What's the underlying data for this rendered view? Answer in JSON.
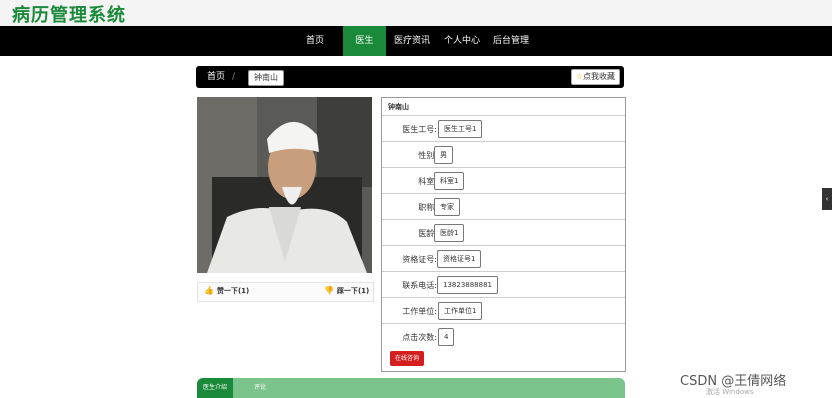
{
  "site": {
    "title": "病历管理系统"
  },
  "nav": {
    "items": [
      {
        "label": "首页"
      },
      {
        "label": "医生"
      },
      {
        "label": "医疗资讯"
      },
      {
        "label": "个人中心"
      },
      {
        "label": "后台管理"
      }
    ],
    "active_index": 1
  },
  "breadcrumb": {
    "home": "首页",
    "separator": "/",
    "current": "钟南山",
    "favorite_label": "点我收藏",
    "favorite_icon": "star-icon"
  },
  "actions": {
    "like": {
      "label": "赞一下(1)",
      "icon": "thumbs-up-icon"
    },
    "dislike": {
      "label": "踩一下(1)",
      "icon": "thumbs-down-icon"
    }
  },
  "doctor": {
    "name": "钟南山",
    "fields": [
      {
        "label": "医生工号:",
        "value": "医生工号1"
      },
      {
        "label": "性别:",
        "value": "男"
      },
      {
        "label": "科室:",
        "value": "科室1"
      },
      {
        "label": "职称:",
        "value": "专家"
      },
      {
        "label": "医龄:",
        "value": "医龄1"
      },
      {
        "label": "资格证号:",
        "value": "资格证号1"
      },
      {
        "label": "联系电话:",
        "value": "13823888881"
      },
      {
        "label": "工作单位:",
        "value": "工作单位1"
      },
      {
        "label": "点击次数:",
        "value": "4"
      }
    ],
    "consult_label": "在线咨询"
  },
  "tabs": [
    {
      "label": "医生介绍"
    },
    {
      "label": "评论"
    }
  ],
  "overlay": {
    "watermark": "CSDN @王倩网络",
    "activate_text": "激活 Windows"
  },
  "colors": {
    "brand_green": "#1a8a3a",
    "nav_bg": "#000000",
    "consult_red": "#d31f1f"
  }
}
